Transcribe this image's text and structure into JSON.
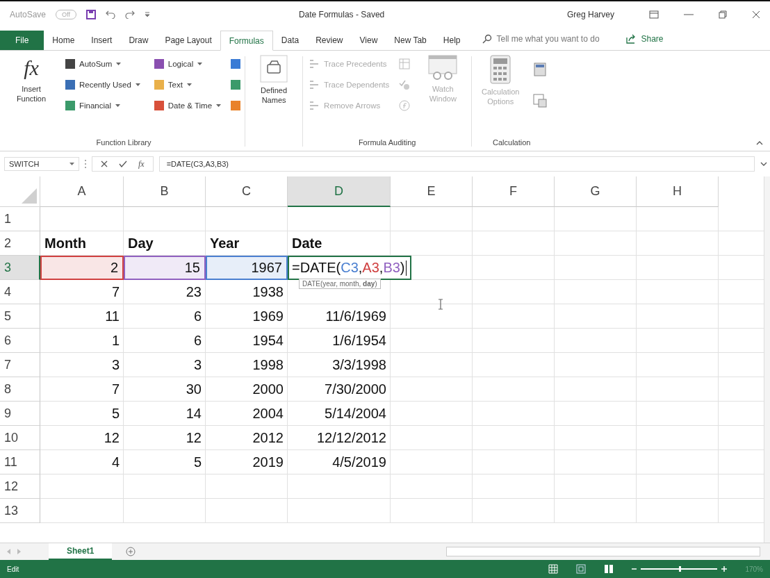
{
  "title_bar": {
    "autosave_label": "AutoSave",
    "autosave_toggle": "Off",
    "document_title": "Date Formulas  -  Saved",
    "user": "Greg Harvey"
  },
  "tabs": [
    {
      "label": "File",
      "kind": "file",
      "selected": false
    },
    {
      "label": "Home",
      "kind": "tab",
      "selected": false
    },
    {
      "label": "Insert",
      "kind": "tab",
      "selected": false
    },
    {
      "label": "Draw",
      "kind": "tab",
      "selected": false
    },
    {
      "label": "Page Layout",
      "kind": "tab",
      "selected": false
    },
    {
      "label": "Formulas",
      "kind": "tab",
      "selected": true
    },
    {
      "label": "Data",
      "kind": "tab",
      "selected": false
    },
    {
      "label": "Review",
      "kind": "tab",
      "selected": false
    },
    {
      "label": "View",
      "kind": "tab",
      "selected": false
    },
    {
      "label": "New Tab",
      "kind": "tab",
      "selected": false
    },
    {
      "label": "Help",
      "kind": "tab",
      "selected": false
    }
  ],
  "tell_me": {
    "placeholder": "Tell me what you want to do"
  },
  "share": "Share",
  "ribbon": {
    "insert_function_glyph": "fx",
    "insert_function": "Insert Function",
    "function_library": {
      "label": "Function Library",
      "items": [
        {
          "label": "AutoSum",
          "color": "#444444"
        },
        {
          "label": "Recently Used",
          "color": "#3a6fb5"
        },
        {
          "label": "Financial",
          "color": "#3b9a6a"
        },
        {
          "label": "Logical",
          "color": "#8a4fb0"
        },
        {
          "label": "Text",
          "color": "#e9b04a"
        },
        {
          "label": "Date & Time",
          "color": "#d8503a"
        }
      ],
      "small_icons": [
        {
          "color": "#3a7bd5"
        },
        {
          "color": "#3b9a6a"
        },
        {
          "color": "#e9822a"
        }
      ]
    },
    "defined_names": "Defined Names",
    "formula_auditing": {
      "label": "Formula Auditing",
      "items": [
        {
          "label": "Trace Precedents",
          "disabled": true
        },
        {
          "label": "Trace Dependents",
          "disabled": true
        },
        {
          "label": "Remove Arrows",
          "disabled": true
        }
      ],
      "watch_window": "Watch Window"
    },
    "calculation": {
      "label": "Calculation",
      "options": "Calculation Options"
    }
  },
  "formula_bar": {
    "name_box": "SWITCH",
    "fx": "fx",
    "formula": "=DATE(C3,A3,B3)"
  },
  "columns": [
    {
      "label": "A",
      "selected": false
    },
    {
      "label": "B",
      "selected": false
    },
    {
      "label": "C",
      "selected": false
    },
    {
      "label": "D",
      "selected": true
    },
    {
      "label": "E",
      "selected": false
    },
    {
      "label": "F",
      "selected": false
    },
    {
      "label": "G",
      "selected": false
    },
    {
      "label": "H",
      "selected": false
    }
  ],
  "rows": [
    {
      "number": "1",
      "cells": []
    },
    {
      "number": "2",
      "cells": [
        {
          "text": "Month",
          "kind": "header"
        },
        {
          "text": "Day",
          "kind": "header"
        },
        {
          "text": "Year",
          "kind": "header"
        },
        {
          "text": "Date",
          "kind": "header"
        }
      ]
    },
    {
      "number": "3",
      "cells": [
        {
          "text": "2",
          "kind": "ref",
          "color": "#d04040"
        },
        {
          "text": "15",
          "kind": "ref",
          "color": "#9060c0"
        },
        {
          "text": "1967",
          "kind": "ref",
          "color": "#4a7fd0"
        },
        {
          "kind": "edit",
          "parts": [
            {
              "text": "=DATE("
            },
            {
              "text": "C3",
              "color": "#4a7fd0"
            },
            {
              "text": ","
            },
            {
              "text": "A3",
              "color": "#d04040"
            },
            {
              "text": ","
            },
            {
              "text": "B3",
              "color": "#9060c0"
            },
            {
              "text": ")"
            }
          ],
          "tooltip": "DATE(year, month, **day**)"
        }
      ]
    },
    {
      "number": "4",
      "cells": [
        {
          "text": "7",
          "kind": "num"
        },
        {
          "text": "23",
          "kind": "num"
        },
        {
          "text": "1938",
          "kind": "num"
        }
      ]
    },
    {
      "number": "5",
      "cells": [
        {
          "text": "11",
          "kind": "num"
        },
        {
          "text": "6",
          "kind": "num"
        },
        {
          "text": "1969",
          "kind": "num"
        },
        {
          "text": "11/6/1969",
          "kind": "num"
        }
      ]
    },
    {
      "number": "6",
      "cells": [
        {
          "text": "1",
          "kind": "num"
        },
        {
          "text": "6",
          "kind": "num"
        },
        {
          "text": "1954",
          "kind": "num"
        },
        {
          "text": "1/6/1954",
          "kind": "num"
        }
      ]
    },
    {
      "number": "7",
      "cells": [
        {
          "text": "3",
          "kind": "num"
        },
        {
          "text": "3",
          "kind": "num"
        },
        {
          "text": "1998",
          "kind": "num"
        },
        {
          "text": "3/3/1998",
          "kind": "num"
        }
      ]
    },
    {
      "number": "8",
      "cells": [
        {
          "text": "7",
          "kind": "num"
        },
        {
          "text": "30",
          "kind": "num"
        },
        {
          "text": "2000",
          "kind": "num"
        },
        {
          "text": "7/30/2000",
          "kind": "num"
        }
      ]
    },
    {
      "number": "9",
      "cells": [
        {
          "text": "5",
          "kind": "num"
        },
        {
          "text": "14",
          "kind": "num"
        },
        {
          "text": "2004",
          "kind": "num"
        },
        {
          "text": "5/14/2004",
          "kind": "num"
        }
      ]
    },
    {
      "number": "10",
      "cells": [
        {
          "text": "12",
          "kind": "num"
        },
        {
          "text": "12",
          "kind": "num"
        },
        {
          "text": "2012",
          "kind": "num"
        },
        {
          "text": "12/12/2012",
          "kind": "num"
        }
      ]
    },
    {
      "number": "11",
      "cells": [
        {
          "text": "4",
          "kind": "num"
        },
        {
          "text": "5",
          "kind": "num"
        },
        {
          "text": "2019",
          "kind": "num"
        },
        {
          "text": "4/5/2019",
          "kind": "num"
        }
      ]
    },
    {
      "number": "12",
      "cells": []
    },
    {
      "number": "13",
      "cells": []
    }
  ],
  "sheets": [
    {
      "label": "Sheet1",
      "selected": true
    }
  ],
  "status_bar": {
    "mode": "Edit",
    "zoom_slider": {
      "level": 0.5
    },
    "zoom": "170%"
  }
}
